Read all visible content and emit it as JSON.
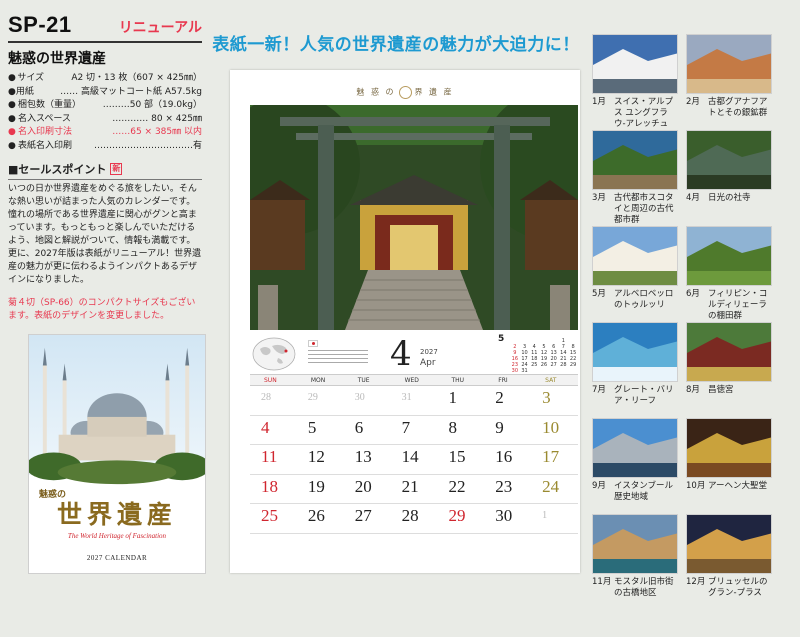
{
  "product": {
    "code": "SP-21",
    "renewal": "リニューアル",
    "title": "魅惑の世界遺産",
    "specs": [
      {
        "key": "サイズ",
        "value": "A2 切・13 枚（607 × 425㎜）",
        "red": false
      },
      {
        "key": "用紙",
        "value": "……  高級マットコート紙 A57.5kg",
        "red": false
      },
      {
        "key": "梱包数（重量）",
        "value": "………50 部（19.0kg）",
        "red": false
      },
      {
        "key": "名入スペース",
        "value": "…………  80 × 425㎜",
        "red": false
      },
      {
        "key": "名入印刷寸法",
        "value": "……65 × 385㎜ 以内",
        "red": true
      },
      {
        "key": "表紙名入印刷",
        "value": "……………………………有",
        "red": false
      }
    ],
    "points_heading": "■セールスポイント",
    "points_mark": "新",
    "points_text": "いつの日か世界遺産をめぐる旅をしたい。そんな熱い思いが詰まった人気のカレンダーです。憧れの場所である世界遺産に関心がグンと高まっています。もっともっと楽しんでいただけるよう、地図と解説がついて、情報も満載です。更に、2027年版は表紙がリニューアル！世界遺産の魅力が更に伝わるようインパクトあるデザインになりました。",
    "red_note": "菊４切（SP-66）のコンパクトサイズもございます。表紙のデザインを変更しました。"
  },
  "cover": {
    "subtitle": "魅惑の",
    "title": "世界遺産",
    "english": "The World Heritage of Fascination",
    "calendar": "2027 CALENDAR"
  },
  "headline": "表紙一新！人気の世界遺産の魅力が大迫力に！",
  "sheet": {
    "title_left": "魅 惑 の",
    "title_right": "界 遺 産",
    "month": "4",
    "year": "2027",
    "month_en": "Apr",
    "mini_month": "5",
    "mini_days": [
      [
        "",
        "",
        "",
        "",
        "",
        "1"
      ],
      [
        "2",
        "3",
        "4",
        "5",
        "6",
        "7",
        "8"
      ],
      [
        "9",
        "10",
        "11",
        "12",
        "13",
        "14",
        "15"
      ],
      [
        "16",
        "17",
        "18",
        "19",
        "20",
        "21",
        "22"
      ],
      [
        "23",
        "24",
        "25",
        "26",
        "27",
        "28",
        "29"
      ],
      [
        "30",
        "31"
      ]
    ],
    "dow": [
      "SUN",
      "MON",
      "TUE",
      "WED",
      "THU",
      "FRI",
      "SAT"
    ],
    "weeks": [
      [
        "28",
        "29",
        "30",
        "31",
        "1",
        "2",
        "3"
      ],
      [
        "4",
        "5",
        "6",
        "7",
        "8",
        "9",
        "10"
      ],
      [
        "11",
        "12",
        "13",
        "14",
        "15",
        "16",
        "17"
      ],
      [
        "18",
        "19",
        "20",
        "21",
        "22",
        "23",
        "24"
      ],
      [
        "25",
        "26",
        "27",
        "28",
        "29",
        "30",
        "1"
      ]
    ]
  },
  "months": [
    {
      "m": "1月",
      "name": "スイス・アルプス ユングフラウ-アレッチュ"
    },
    {
      "m": "2月",
      "name": "古都グアナフアトとその銀鉱群"
    },
    {
      "m": "3月",
      "name": "古代都市スコタイと周辺の古代都市群"
    },
    {
      "m": "4月",
      "name": "日光の社寺"
    },
    {
      "m": "5月",
      "name": "アルベロベッロのトゥルッリ"
    },
    {
      "m": "6月",
      "name": "フィリピン・コルディリェーラの棚田群"
    },
    {
      "m": "7月",
      "name": "グレート・バリア・リーフ"
    },
    {
      "m": "8月",
      "name": "昌徳宮"
    },
    {
      "m": "9月",
      "name": "イスタンブール歴史地域"
    },
    {
      "m": "10月",
      "name": "アーヘン大聖堂"
    },
    {
      "m": "11月",
      "name": "モスタル旧市街の古橋地区"
    },
    {
      "m": "12月",
      "name": "ブリュッセルのグラン-プラス"
    }
  ]
}
